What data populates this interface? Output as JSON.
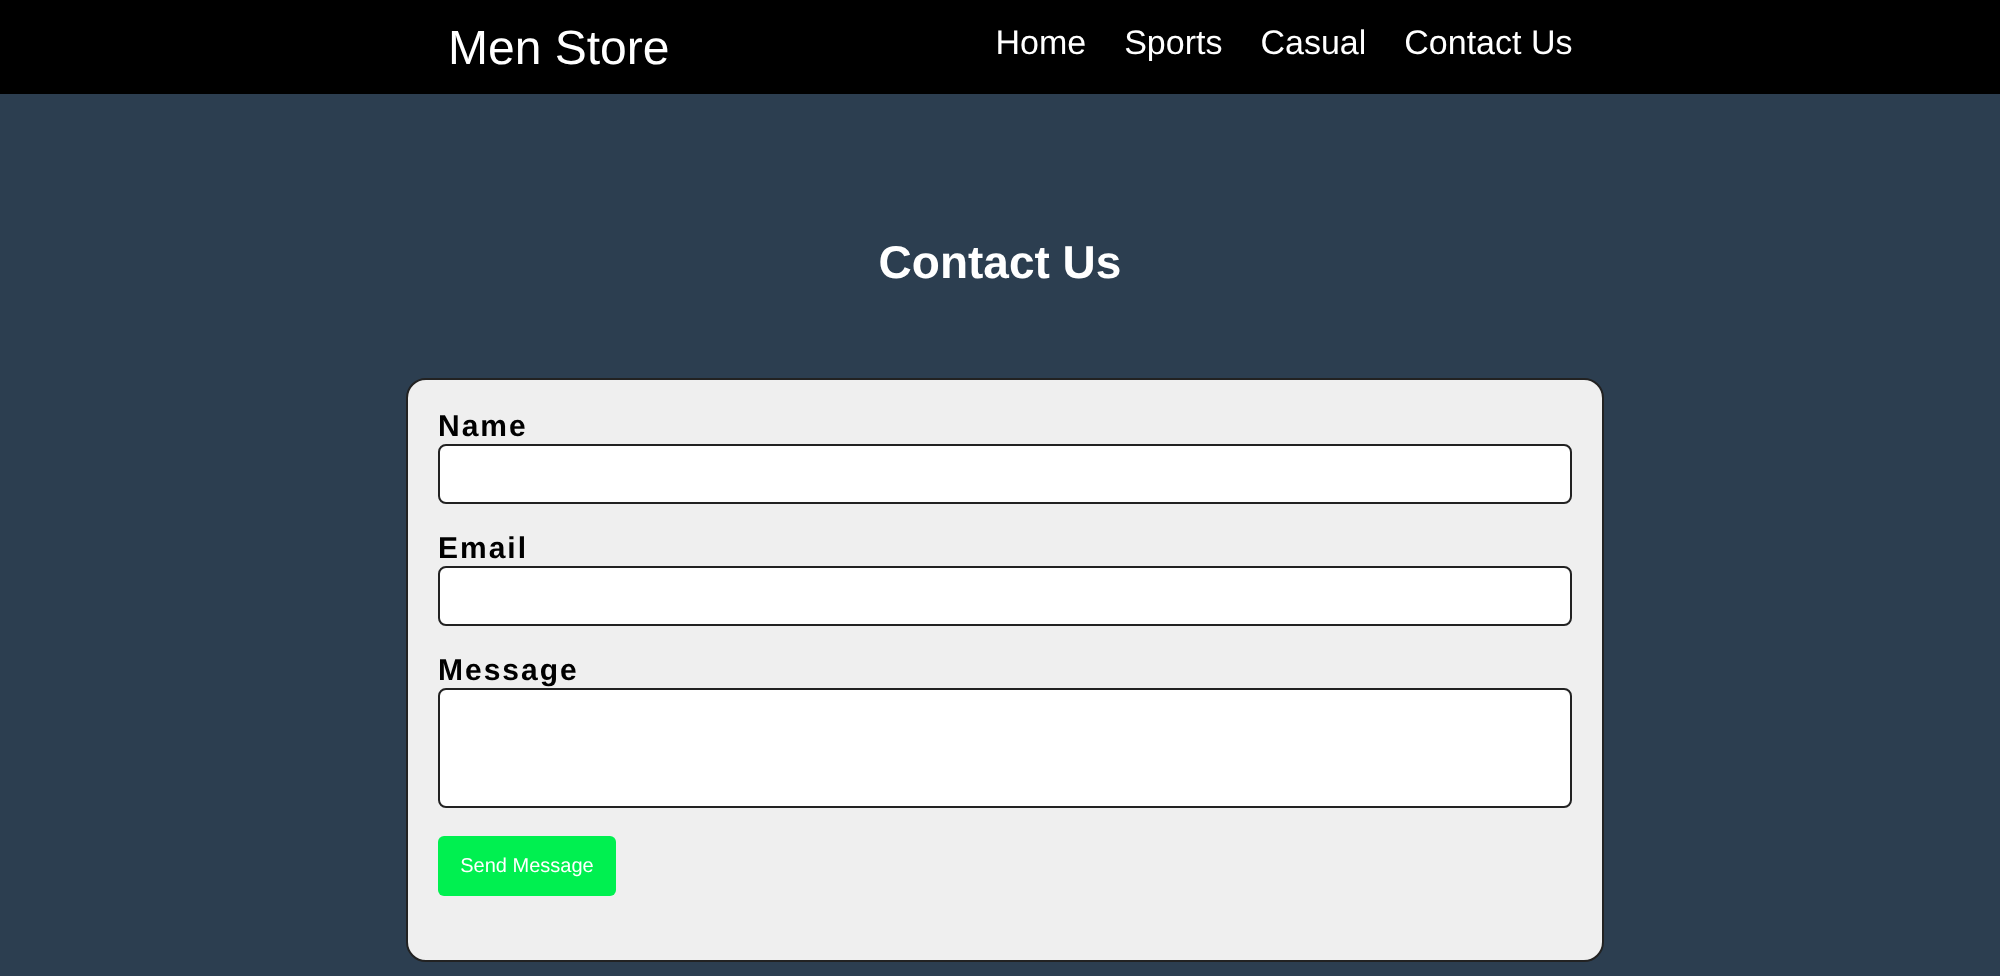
{
  "navbar": {
    "brand": "Men Store",
    "links": [
      "Home",
      "Sports",
      "Casual",
      "Contact Us"
    ]
  },
  "heading": "Contact Us",
  "form": {
    "fields": [
      {
        "label": "Name",
        "kind": "input"
      },
      {
        "label": "Email",
        "kind": "input"
      },
      {
        "label": "Message",
        "kind": "textarea"
      }
    ],
    "submit": "Send Message"
  }
}
